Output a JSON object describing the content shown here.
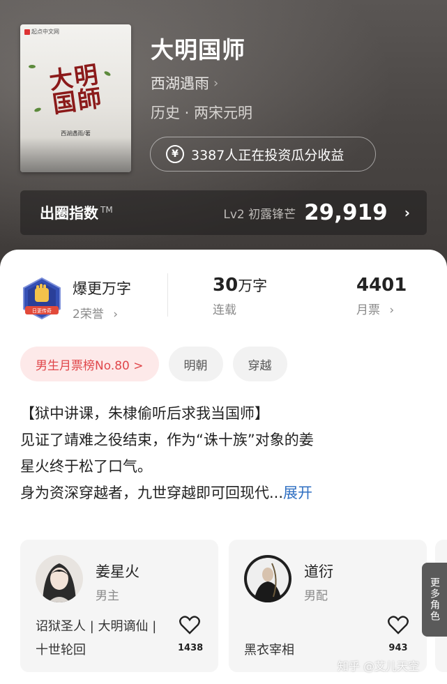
{
  "book": {
    "title": "大明国师",
    "author": "西湖遇雨",
    "genre": "历史 · 两宋元明",
    "invest_text": "3387人正在投资瓜分收益",
    "cover": {
      "brand": "起点中文网",
      "title_chars": [
        "大",
        "明",
        "国",
        "師"
      ],
      "author_line": "西湖遇雨/著"
    }
  },
  "index_bar": {
    "label": "出圈指数",
    "tm": "TM",
    "level": "Lv2 初露锋芒",
    "value": "29,919"
  },
  "stats": {
    "honor_title": "爆更万字",
    "honor_sub": "2荣誉",
    "badge_text": "日更传奇",
    "words_num": "30",
    "words_unit": "万字",
    "status": "连载",
    "tickets": "4401",
    "tickets_label": "月票"
  },
  "tags": [
    "男生月票榜No.80 >",
    "明朝",
    "穿越"
  ],
  "description": {
    "lines": [
      "【狱中讲课，朱棣偷听后求我当国师】",
      "见证了靖难之役结束，作为“诛十族”对象的姜",
      "星火终于松了口气。",
      "身为资深穿越者，九世穿越即可回现代..."
    ],
    "expand": "展开"
  },
  "roles": [
    {
      "name": "姜星火",
      "type": "男主",
      "desc": "诏狱圣人 | 大明谪仙 | 十世轮回",
      "likes": "1438"
    },
    {
      "name": "道衍",
      "type": "男配",
      "desc": "黑衣宰相",
      "likes": "943"
    }
  ],
  "more_roles": "更多角色",
  "watermark": "知乎 @艾儿天空",
  "colors": {
    "accent_red": "#e0474b",
    "link_blue": "#2f6fc2",
    "header_bg": "#4a4644"
  }
}
